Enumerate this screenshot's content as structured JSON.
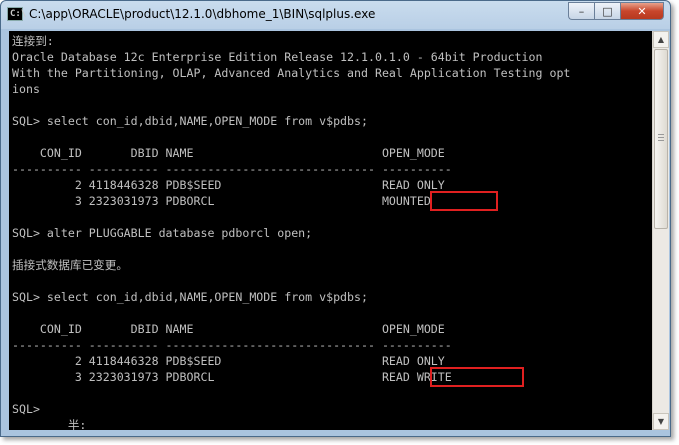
{
  "window": {
    "title": "C:\\app\\ORACLE\\product\\12.1.0\\dbhome_1\\BIN\\sqlplus.exe",
    "controls": {
      "minimize": "–",
      "maximize": "□",
      "close": "✕"
    }
  },
  "console": {
    "lines": [
      "连接到:",
      "Oracle Database 12c Enterprise Edition Release 12.1.0.1.0 - 64bit Production",
      "With the Partitioning, OLAP, Advanced Analytics and Real Application Testing opt",
      "ions",
      "",
      "SQL> select con_id,dbid,NAME,OPEN_MODE from v$pdbs;",
      "",
      "    CON_ID       DBID NAME                           OPEN_MODE",
      "---------- ---------- ------------------------------ ----------",
      "         2 4118446328 PDB$SEED                       READ ONLY",
      "         3 2323031973 PDBORCL                        MOUNTED",
      "",
      "SQL> alter PLUGGABLE database pdborcl open;",
      "",
      "插接式数据库已变更。",
      "",
      "SQL> select con_id,dbid,NAME,OPEN_MODE from v$pdbs;",
      "",
      "    CON_ID       DBID NAME                           OPEN_MODE",
      "---------- ---------- ------------------------------ ----------",
      "         2 4118446328 PDB$SEED                       READ ONLY",
      "         3 2323031973 PDBORCL                        READ WRITE",
      "",
      "SQL>",
      "        半:"
    ]
  },
  "colors": {
    "console_bg": "#000000",
    "console_text": "#c0c0c0",
    "highlight_box": "#e02020"
  },
  "icons": {
    "app": "console-icon",
    "scroll_up": "arrow-up-icon",
    "scroll_down": "arrow-down-icon"
  }
}
